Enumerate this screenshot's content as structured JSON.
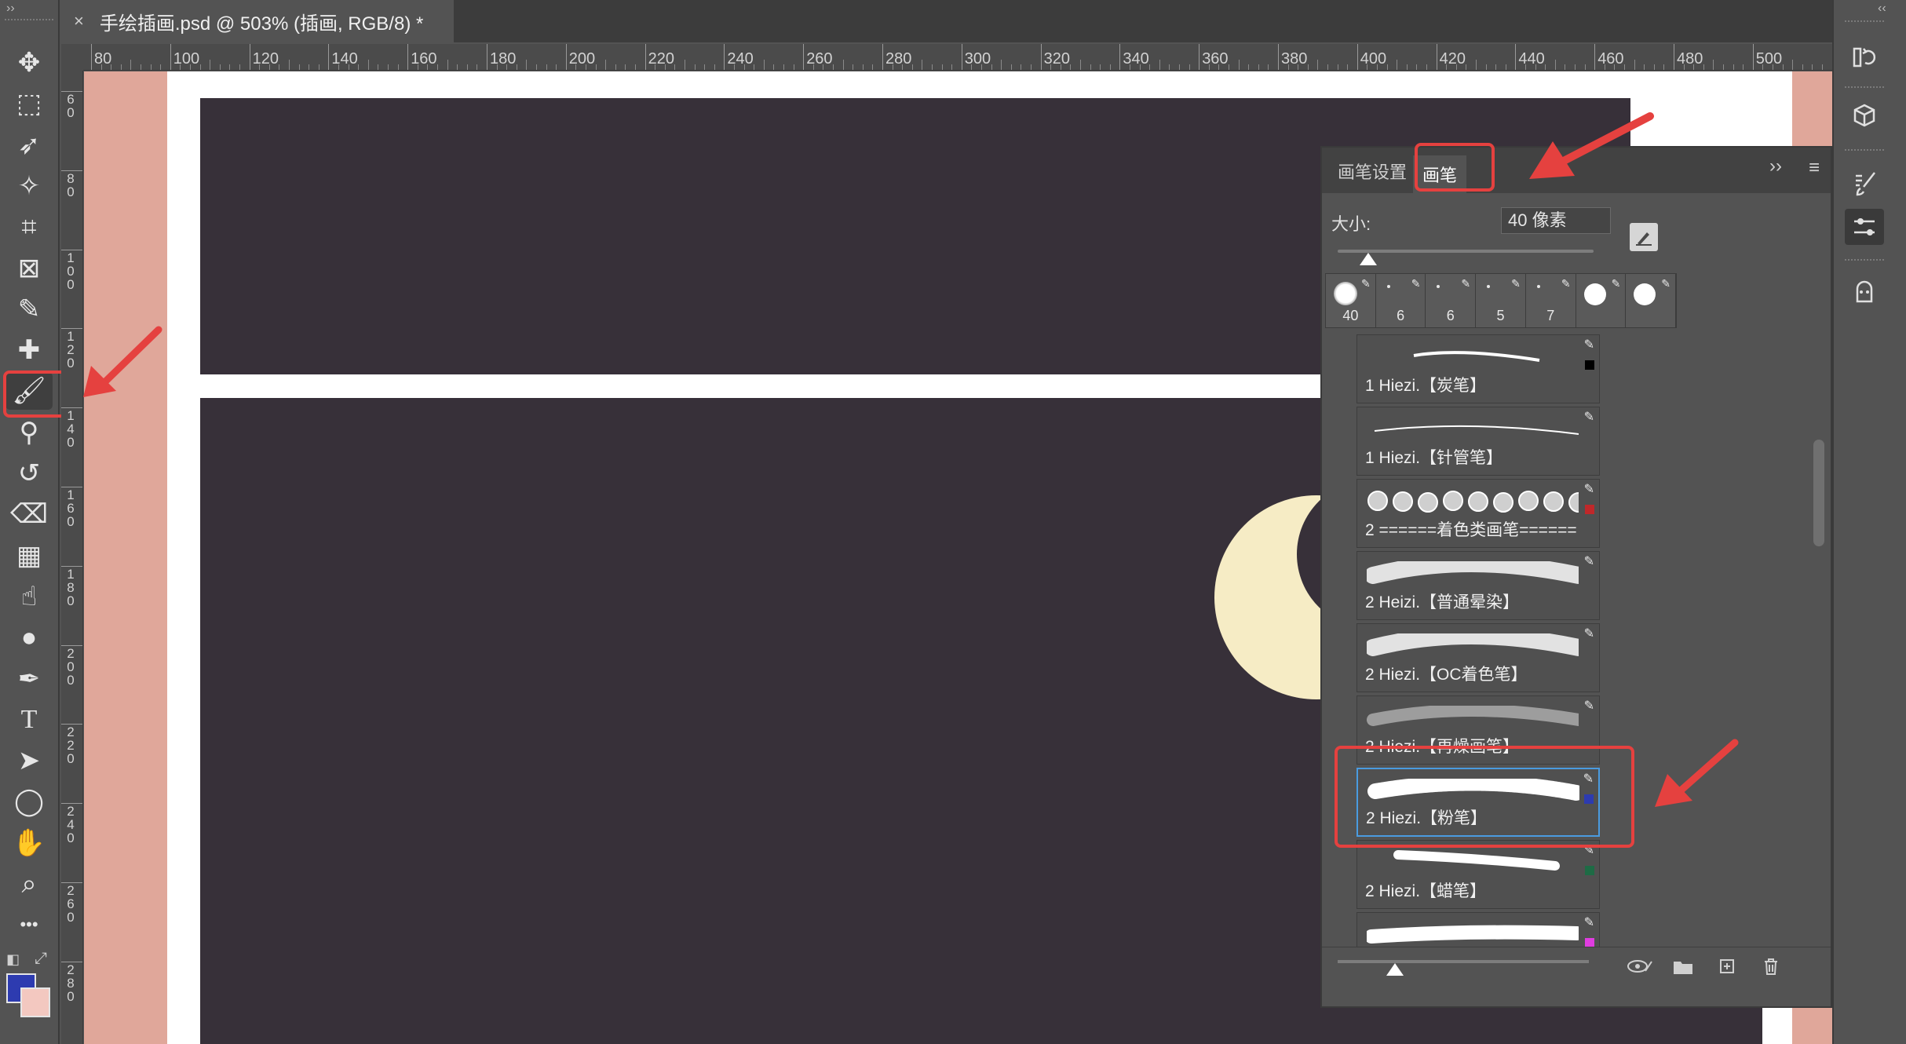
{
  "document_tab": {
    "close_label": "×",
    "title": "手绘插画.psd @ 503% (插画, RGB/8) *"
  },
  "rulers": {
    "top_labels": [
      "80",
      "100",
      "120",
      "140",
      "160",
      "180",
      "200",
      "220",
      "240",
      "260",
      "280",
      "300",
      "320",
      "340",
      "360",
      "380",
      "400",
      "420",
      "440",
      "460",
      "480",
      "500"
    ],
    "left_labels": [
      "60",
      "80",
      "100",
      "120",
      "140",
      "160",
      "180",
      "200",
      "220",
      "240",
      "260",
      "280"
    ]
  },
  "toolbar": {
    "tools": [
      {
        "name": "move-tool-icon",
        "glyph": "✥"
      },
      {
        "name": "marquee-tool-icon",
        "glyph": "⬚"
      },
      {
        "name": "lasso-tool-icon",
        "glyph": "➶"
      },
      {
        "name": "magic-wand-tool-icon",
        "glyph": "✧"
      },
      {
        "name": "crop-tool-icon",
        "glyph": "⌗"
      },
      {
        "name": "frame-tool-icon",
        "glyph": "⊠"
      },
      {
        "name": "eyedropper-tool-icon",
        "glyph": "✎"
      },
      {
        "name": "healing-brush-tool-icon",
        "glyph": "✚"
      },
      {
        "name": "brush-tool-icon",
        "glyph": "🖌"
      },
      {
        "name": "stamp-tool-icon",
        "glyph": "⚲"
      },
      {
        "name": "history-brush-tool-icon",
        "glyph": "↺"
      },
      {
        "name": "eraser-tool-icon",
        "glyph": "⌫"
      },
      {
        "name": "gradient-tool-icon",
        "glyph": "▦"
      },
      {
        "name": "smudge-tool-icon",
        "glyph": "☝"
      },
      {
        "name": "dodge-tool-icon",
        "glyph": "●"
      },
      {
        "name": "pen-tool-icon",
        "glyph": "✒"
      },
      {
        "name": "type-tool-icon",
        "glyph": "T"
      },
      {
        "name": "path-selection-tool-icon",
        "glyph": "➤"
      },
      {
        "name": "ellipse-tool-icon",
        "glyph": "◯"
      },
      {
        "name": "hand-tool-icon",
        "glyph": "✋"
      },
      {
        "name": "zoom-tool-icon",
        "glyph": "⌕"
      },
      {
        "name": "more-tools-icon",
        "glyph": "•••"
      }
    ],
    "foreground_color": "#2d3bb0",
    "background_color": "#f3c8c0"
  },
  "brush_panel": {
    "tabs": [
      "画笔设置",
      "画笔"
    ],
    "active_tab": "画笔",
    "size_label": "大小:",
    "size_value": "40 像素",
    "size_slider_fraction": 0.12,
    "recent_presets": [
      {
        "size": "40",
        "shape": "soft"
      },
      {
        "size": "6",
        "shape": "dots"
      },
      {
        "size": "6",
        "shape": "dots"
      },
      {
        "size": "5",
        "shape": "dots"
      },
      {
        "size": "7",
        "shape": "dots"
      },
      {
        "size": "",
        "shape": "round"
      },
      {
        "size": "",
        "shape": "round"
      }
    ],
    "brushes": [
      {
        "name": "1 Hiezi.【炭笔】",
        "swatch": "#000000",
        "stroke": "thin"
      },
      {
        "name": "1 Hiezi.【针管笔】",
        "swatch": "",
        "stroke": "hair"
      },
      {
        "name": "2 ======着色类画笔======",
        "swatch": "#c0282a",
        "stroke": "circles"
      },
      {
        "name": "2 Heizi.【普通晕染】",
        "swatch": "",
        "stroke": "soft"
      },
      {
        "name": "2 Hiezi.【OC着色笔】",
        "swatch": "",
        "stroke": "soft"
      },
      {
        "name": "2 Hiezi.【再燥画笔】",
        "swatch": "",
        "stroke": "faint"
      },
      {
        "name": "2 Hiezi.【粉笔】",
        "swatch": "#2d3bb0",
        "stroke": "chalk"
      },
      {
        "name": "2 Hiezi.【蜡笔】",
        "swatch": "#1e6b45",
        "stroke": "crayon"
      },
      {
        "name": "",
        "swatch": "#e03de0",
        "stroke": "solid"
      }
    ],
    "selected_brush_index": 6,
    "expand_label": "››",
    "menu_label": "≡"
  },
  "colors": {
    "canvas_bg": "#e0a79a",
    "panel_dark": "#373039",
    "moon": "#f6ecc5",
    "annotation_red": "#e5413f"
  }
}
